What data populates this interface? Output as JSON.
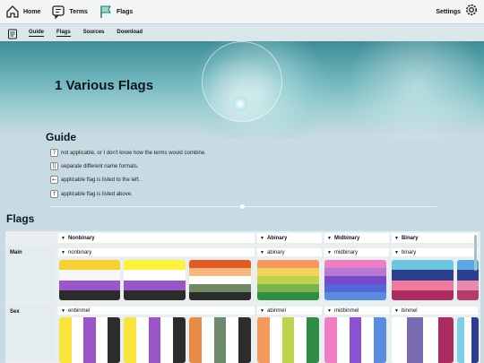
{
  "topnav": {
    "home_label": "Home",
    "terms_label": "Terms",
    "flags_label": "Flags",
    "settings_label": "Settings"
  },
  "subnav": {
    "tabs": [
      "Guide",
      "Flags",
      "Sources",
      "Download"
    ],
    "active": [
      "Guide",
      "Flags"
    ]
  },
  "hero": {
    "title": "1 Various Flags"
  },
  "guide": {
    "title": "Guide",
    "items": [
      {
        "symbol": "?",
        "text": "not applicable, or I don't know how the terms would combine."
      },
      {
        "symbol": "||",
        "text": "separate different name formats."
      },
      {
        "symbol": "←",
        "text": "applicable flag is listed to the left."
      },
      {
        "symbol": "↑",
        "text": "applicable flag is listed above."
      }
    ]
  },
  "flags": {
    "heading": "Flags",
    "columns": [
      {
        "label": "Nonbinary",
        "main_term": "nonbinary",
        "sex_term": "enbinmel"
      },
      {
        "label": "Abinary",
        "main_term": "abinary",
        "sex_term": "abinmel"
      },
      {
        "label": "Midbinary",
        "main_term": "midbinary",
        "sex_term": "midbinmel"
      },
      {
        "label": "Binary",
        "main_term": "binary",
        "sex_term": "binmel"
      }
    ],
    "rows": [
      "Main",
      "Sex"
    ]
  },
  "colors": {
    "nonbinary": [
      "#f6d130",
      "#f6f6f6",
      "#9a55c8",
      "#2c2c2c"
    ],
    "nonbinary_alt": [
      "#fdf23a",
      "#ffffff",
      "#9a55c8",
      "#2c2c2c"
    ],
    "genderqueer_orange": [
      "#e35a24",
      "#f2b87e",
      "#ffffff",
      "#6e8a63",
      "#2c2c2c"
    ],
    "abinary": [
      "#f59a5c",
      "#f2d25a",
      "#bfd24b",
      "#7ab34c",
      "#2f8e45"
    ],
    "midbinary": [
      "#f07ec2",
      "#b47ad6",
      "#7b48c9",
      "#5566d8",
      "#5a8de2"
    ],
    "binary": [
      "#6dc6e0",
      "#2d3e8e",
      "#f07a9b",
      "#ab2c5e"
    ],
    "binary_partial": [
      "#5aa9e0",
      "#2f3f90",
      "#e88aab",
      "#b43c6a"
    ],
    "enbinmel_1": [
      "#f8e43a",
      "#ffffff",
      "#9c55c9",
      "#ffffff",
      "#2c2c2c"
    ],
    "enbinmel_2": [
      "#f8e43a",
      "#ffffff",
      "#9c55c9",
      "#ffffff",
      "#2c2c2c"
    ],
    "enbinmel_3": [
      "#e88b45",
      "#ffffff",
      "#6d8a6d",
      "#ffffff",
      "#2c2c2c"
    ],
    "abinmel": [
      "#f59a5c",
      "#ffffff",
      "#bfd24b",
      "#ffffff",
      "#2f8e45"
    ],
    "midbinmel": [
      "#f07ec2",
      "#ffffff",
      "#8a52d0",
      "#ffffff",
      "#5a8de2"
    ],
    "binmel": [
      "#ffffff",
      "#7a6bb0",
      "#ffffff",
      "#ab2c5e"
    ],
    "binmel_partial": [
      "#7bd0e8",
      "#ffffff",
      "#2d3e8e"
    ]
  }
}
